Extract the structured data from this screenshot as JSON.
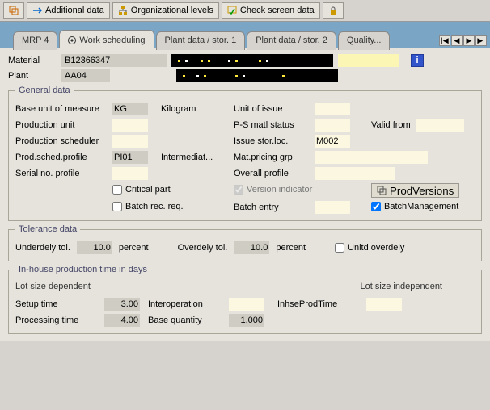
{
  "toolbar": {
    "additional_data": "Additional data",
    "org_levels": "Organizational levels",
    "check_screen": "Check screen data"
  },
  "tabs": {
    "mrp4": "MRP 4",
    "work_scheduling": "Work scheduling",
    "plant1": "Plant data / stor. 1",
    "plant2": "Plant data / stor. 2",
    "quality": "Quality..."
  },
  "header": {
    "material_lbl": "Material",
    "material": "B12366347",
    "plant_lbl": "Plant",
    "plant": "AA04"
  },
  "general": {
    "legend": "General data",
    "base_uom_lbl": "Base unit of measure",
    "base_uom": "KG",
    "base_uom_text": "Kilogram",
    "unit_issue_lbl": "Unit of issue",
    "prod_unit_lbl": "Production unit",
    "ps_status_lbl": "P-S matl status",
    "valid_from_lbl": "Valid from",
    "prod_sched_lbl": "Production scheduler",
    "issue_loc_lbl": "Issue stor.loc.",
    "issue_loc": "M002",
    "prod_prof_lbl": "Prod.sched.profile",
    "prod_prof": "PI01",
    "prod_prof_text": "Intermediat...",
    "mat_price_lbl": "Mat.pricing grp",
    "serial_lbl": "Serial no. profile",
    "overall_lbl": "Overall profile",
    "critical_lbl": "Critical part",
    "version_lbl": "Version indicator",
    "prodversions_btn": "ProdVersions",
    "batch_rec_lbl": "Batch rec. req.",
    "batch_entry_lbl": "Batch entry",
    "batch_mgmt_lbl": "BatchManagement"
  },
  "tolerance": {
    "legend": "Tolerance data",
    "under_lbl": "Underdely tol.",
    "under": "10.0",
    "percent": "percent",
    "over_lbl": "Overdely tol.",
    "over": "10.0",
    "unltd_lbl": "Unltd overdely"
  },
  "inhouse": {
    "legend": "In-house production time in days",
    "lot_dep": "Lot size dependent",
    "lot_indep": "Lot size independent",
    "setup_lbl": "Setup time",
    "setup": "3.00",
    "interop_lbl": "Interoperation",
    "inhse_lbl": "InhseProdTime",
    "proc_lbl": "Processing time",
    "proc": "4.00",
    "baseq_lbl": "Base quantity",
    "baseq": "1.000"
  }
}
